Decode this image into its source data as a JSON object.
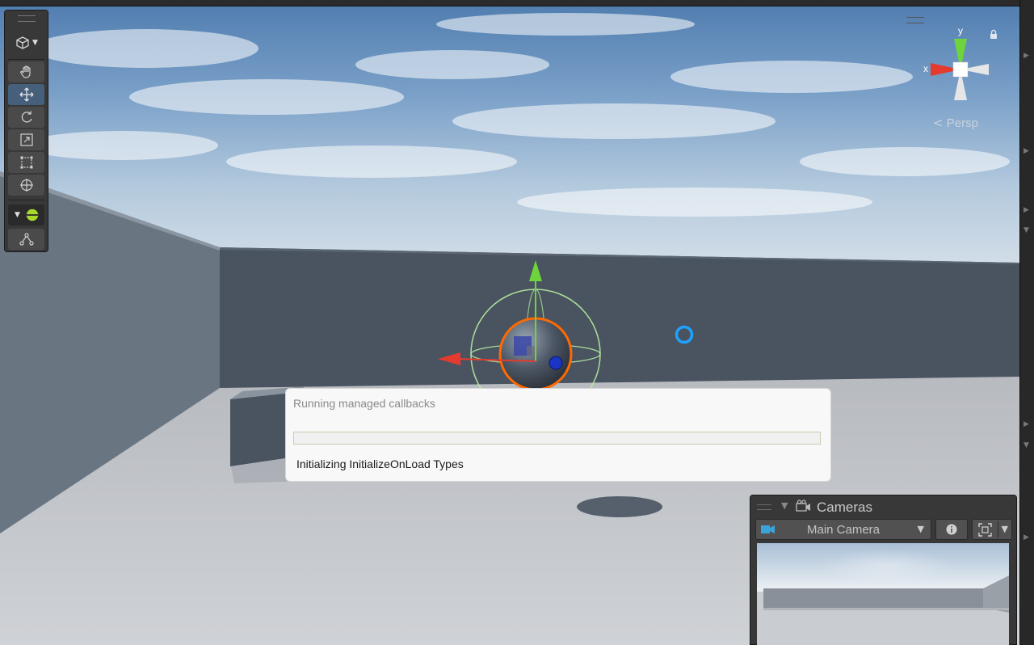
{
  "scene_view": {
    "orientation_gizmo": {
      "axis_x_label": "x",
      "axis_y_label": "y",
      "projection_label": "Persp"
    }
  },
  "toolbar": {
    "tools": [
      {
        "name": "view-tool",
        "icon": "hand-icon",
        "active": false
      },
      {
        "name": "move-tool",
        "icon": "move-arrows-icon",
        "active": true
      },
      {
        "name": "rotate-tool",
        "icon": "rotate-icon",
        "active": false
      },
      {
        "name": "scale-tool",
        "icon": "scale-icon",
        "active": false
      },
      {
        "name": "rect-tool",
        "icon": "rect-icon",
        "active": false
      },
      {
        "name": "transform-tool",
        "icon": "transform-icon",
        "active": false
      }
    ]
  },
  "progress_dialog": {
    "title": "Running managed callbacks",
    "status": "Initializing InitializeOnLoad Types",
    "progress": 0.0
  },
  "cameras_overlay": {
    "title": "Cameras",
    "selected_camera": "Main Camera"
  },
  "colors": {
    "sky_top": "#5d85b3",
    "wall": "#4a5360",
    "ground": "#c2c5c9",
    "selection_orange": "#ff6a00",
    "axis_x": "#e53b2e",
    "axis_y": "#6fd43b",
    "axis_z": "#2f5bd8",
    "panel_bg": "#383838",
    "active_tool": "#46607c"
  }
}
